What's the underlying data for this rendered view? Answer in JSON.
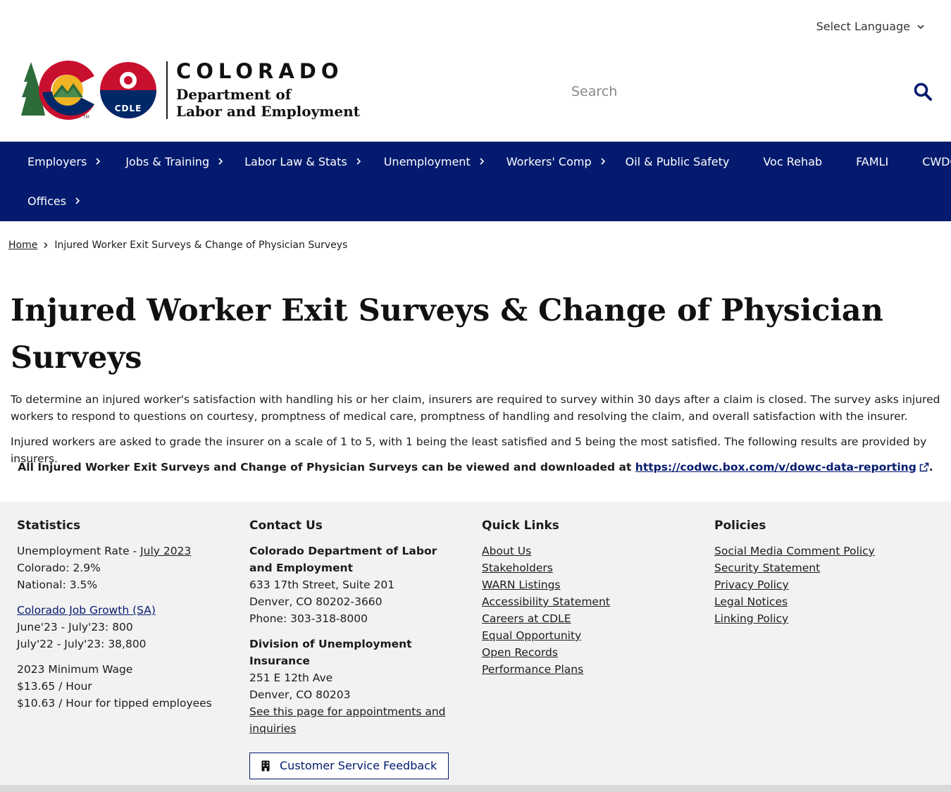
{
  "header": {
    "language_select": "Select Language",
    "logo": {
      "state": "COLORADO",
      "dept_line1": "Department of",
      "dept_line2": "Labor and Employment",
      "badge": "CDLE"
    },
    "search": {
      "placeholder": "Search",
      "icon": "search-icon"
    }
  },
  "nav": {
    "items": [
      {
        "label": "Employers",
        "has_children": true
      },
      {
        "label": "Jobs & Training",
        "has_children": true
      },
      {
        "label": "Labor Law & Stats",
        "has_children": true
      },
      {
        "label": "Unemployment",
        "has_children": true
      },
      {
        "label": "Workers' Comp",
        "has_children": true
      },
      {
        "label": "Oil & Public Safety",
        "has_children": false
      },
      {
        "label": "Voc Rehab",
        "has_children": false
      },
      {
        "label": "FAMLI",
        "has_children": false
      },
      {
        "label": "CWDC",
        "has_children": false
      },
      {
        "label": "Offices",
        "has_children": true
      }
    ]
  },
  "breadcrumb": {
    "home": "Home",
    "current": "Injured Worker Exit Surveys & Change of Physician Surveys"
  },
  "main": {
    "title": "Injured Worker Exit Surveys & Change of Physician Surveys",
    "paragraph1": "To determine an injured worker's satisfaction with handling his or her claim, insurers are required to survey within 30 days after a claim is closed. The survey asks injured workers to respond to questions on courtesy, promptness of medical care, promptness of handling and resolving the claim, and overall satisfaction with the insurer.",
    "paragraph2": "Injured workers are asked to grade the insurer on a scale of 1 to 5, with 1 being the least satisfied and 5 being the most satisfied. The following results are provided by insurers.",
    "notice_text": "All Injured Worker Exit Surveys and Change of Physician Surveys can be viewed and downloaded at ",
    "notice_link": "https://codwc.box.com/v/dowc-data-reporting",
    "notice_end": "."
  },
  "footer": {
    "statistics": {
      "heading": "Statistics",
      "unemployment_prefix": "Unemployment Rate - ",
      "unemployment_link": "July 2023",
      "colorado": "Colorado: 2.9%",
      "national": "National: 3.5%",
      "job_growth_link": "Colorado Job Growth (SA)",
      "growth_month": "June'23 - July'23: 800",
      "growth_year": "July'22 - July'23: 38,800",
      "min_wage_title": "2023 Minimum Wage",
      "min_wage": "$13.65 / Hour",
      "min_wage_tipped": "$10.63 / Hour for tipped employees"
    },
    "contact": {
      "heading": "Contact Us",
      "org": "Colorado Department of Labor and Employment",
      "address1": "633 17th Street, Suite 201",
      "address2": "Denver, CO  80202-3660",
      "phone": "Phone: 303-318-8000",
      "division": "Division of Unemployment Insurance",
      "div_address1": "251 E 12th Ave",
      "div_address2": "Denver, CO  80203",
      "appointments_link": "See this page for appointments and inquiries",
      "feedback_button": "Customer Service Feedback"
    },
    "quick_links": {
      "heading": "Quick Links",
      "items": [
        "About Us",
        "Stakeholders",
        "WARN Listings",
        "Accessibility Statement",
        "Careers at CDLE",
        "Equal Opportunity",
        "Open Records",
        "Performance Plans"
      ]
    },
    "policies": {
      "heading": "Policies",
      "items": [
        "Social Media Comment Policy",
        "Security Statement",
        "Privacy Policy",
        "Legal Notices",
        "Linking Policy"
      ]
    }
  },
  "colors": {
    "nav_bg": "#031a6e",
    "link_blue": "#031a6e",
    "footer_bg": "#f2f2f2",
    "logo_red": "#c8102e",
    "logo_gold": "#f0b323",
    "logo_green": "#2e6b3a"
  }
}
